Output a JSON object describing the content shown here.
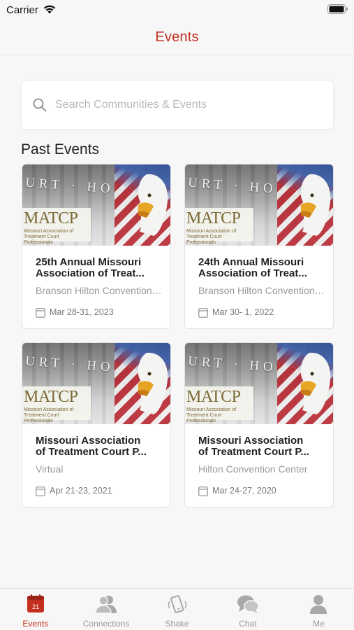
{
  "status_bar": {
    "carrier": "Carrier"
  },
  "nav": {
    "title": "Events"
  },
  "search": {
    "placeholder": "Search Communities & Events",
    "value": ""
  },
  "section": {
    "title": "Past Events"
  },
  "events": [
    {
      "title_line1": "25th Annual Missouri",
      "title_line2": "Association of Treat...",
      "location": "Branson Hilton Convention ...",
      "date": "Mar 28-31, 2023"
    },
    {
      "title_line1": "24th Annual Missouri",
      "title_line2": "Association of Treat...",
      "location": "Branson Hilton Convention ...",
      "date": "Mar 30- 1, 2022"
    },
    {
      "title_line1": "Missouri Association",
      "title_line2": "of Treatment Court P...",
      "location": "Virtual",
      "date": "Apr 21-23, 2021"
    },
    {
      "title_line1": "Missouri Association",
      "title_line2": "of Treatment Court P...",
      "location": "Hilton Convention Center",
      "date": "Mar 24-27, 2020"
    }
  ],
  "event_image": {
    "courthouse_text": "URT · HOUSE",
    "logo_text": "MATCP",
    "logo_subtext": "Missouri Association of Treatment Court Professionals"
  },
  "tabs": [
    {
      "label": "Events",
      "icon": "calendar-icon",
      "badge": "21",
      "active": true
    },
    {
      "label": "Connections",
      "icon": "people-icon",
      "active": false
    },
    {
      "label": "Shake",
      "icon": "phone-shake-icon",
      "active": false
    },
    {
      "label": "Chat",
      "icon": "chat-bubbles-icon",
      "active": false
    },
    {
      "label": "Me",
      "icon": "person-icon",
      "active": false
    }
  ],
  "colors": {
    "accent": "#c4301f",
    "background": "#f7f7f7",
    "card": "#ffffff",
    "muted_text": "#9a9a9a"
  }
}
